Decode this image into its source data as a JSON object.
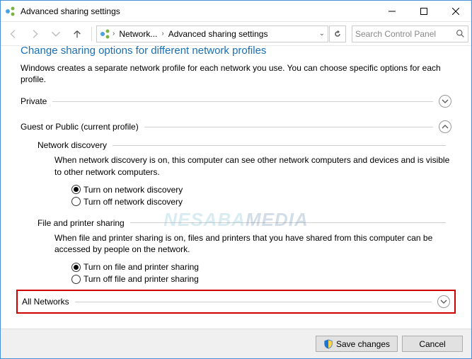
{
  "window": {
    "title": "Advanced sharing settings"
  },
  "nav": {
    "crumb1": "Network...",
    "crumb2": "Advanced sharing settings",
    "search_placeholder": "Search Control Panel"
  },
  "page": {
    "heading": "Change sharing options for different network profiles",
    "description": "Windows creates a separate network profile for each network you use. You can choose specific options for each profile."
  },
  "sections": {
    "private": {
      "label": "Private"
    },
    "guest": {
      "label": "Guest or Public (current profile)",
      "network_discovery": {
        "title": "Network discovery",
        "desc": "When network discovery is on, this computer can see other network computers and devices and is visible to other network computers.",
        "opt_on": "Turn on network discovery",
        "opt_off": "Turn off network discovery"
      },
      "file_sharing": {
        "title": "File and printer sharing",
        "desc": "When file and printer sharing is on, files and printers that you have shared from this computer can be accessed by people on the network.",
        "opt_on": "Turn on file and printer sharing",
        "opt_off": "Turn off file and printer sharing"
      }
    },
    "all_networks": {
      "label": "All Networks"
    }
  },
  "footer": {
    "save": "Save changes",
    "cancel": "Cancel"
  },
  "watermark": {
    "part1": "NESABA",
    "part2": "MEDIA"
  }
}
